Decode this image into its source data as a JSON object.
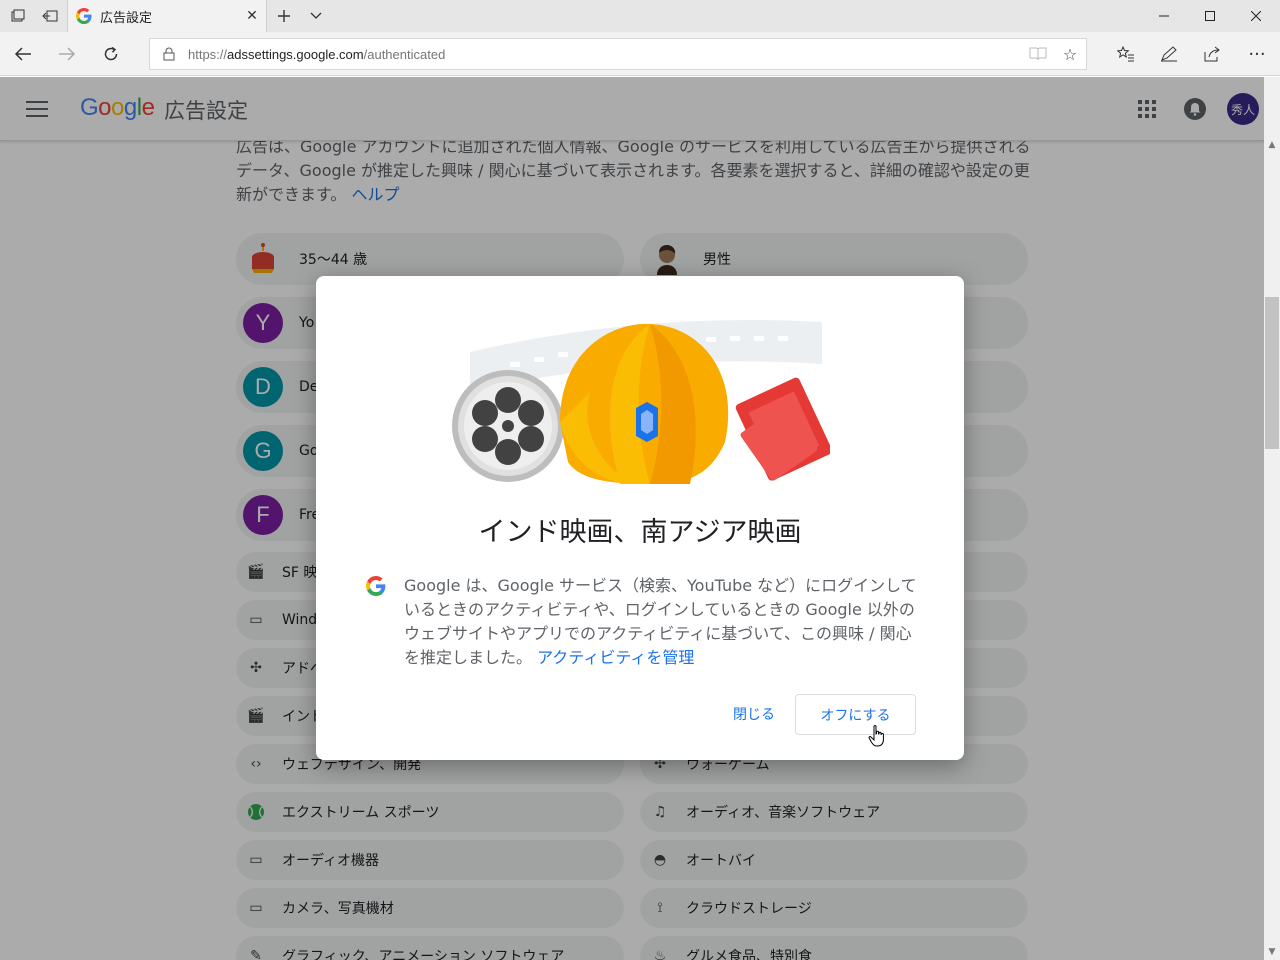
{
  "browser": {
    "tab_title": "広告設定",
    "url_scheme": "https://",
    "url_host": "adssettings.google.com",
    "url_path": "/authenticated",
    "window_buttons": [
      "minimize-icon",
      "maximize-icon",
      "close-icon"
    ]
  },
  "header": {
    "logo_text": "Google",
    "product_name": "広告設定",
    "avatar_text": "秀人",
    "avatar_color": "#3b2a88"
  },
  "intro": {
    "text": "広告は、Google アカウントに追加された個人情報、Google のサービスを利用している広告主から提供されるデータ、Google が推定した興味 / 関心に基づいて表示されます。各要素を選択すると、詳細の確認や設定の更新ができます。",
    "help_link": "ヘルプ"
  },
  "tiles": {
    "left": [
      {
        "label": "35～44 歳",
        "avatar": "",
        "color": ""
      },
      {
        "label": "Yo",
        "avatar": "Y",
        "color": "#7b1fa2"
      },
      {
        "label": "De",
        "avatar": "D",
        "color": "#0097a7"
      },
      {
        "label": "Go",
        "avatar": "G",
        "color": "#0097a7"
      },
      {
        "label": "Fre",
        "avatar": "F",
        "color": "#7b1fa2"
      }
    ],
    "right": [
      {
        "label": "男性"
      }
    ],
    "small_left": [
      {
        "label": "SF 映",
        "icon": "clapper-icon"
      },
      {
        "label": "Windo",
        "icon": "laptop-icon"
      },
      {
        "label": "アドベ",
        "icon": "gamepad-icon"
      },
      {
        "label": "インド",
        "icon": "clapper-icon"
      },
      {
        "label": "ウェブデザイン、開発",
        "icon": "code-icon"
      },
      {
        "label": "エクストリーム スポーツ",
        "icon": "ball-icon"
      },
      {
        "label": "オーディオ機器",
        "icon": "laptop-icon"
      },
      {
        "label": "カメラ、写真機材",
        "icon": "laptop-icon"
      },
      {
        "label": "グラフィック、アニメーション ソフトウェア",
        "icon": "pen-icon"
      }
    ],
    "small_right": [
      {
        "label": "ウォーゲーム",
        "icon": "gamepad-icon"
      },
      {
        "label": "オーディオ、音楽ソフトウェア",
        "icon": "music-icon"
      },
      {
        "label": "オートバイ",
        "icon": "helmet-icon"
      },
      {
        "label": "クラウドストレージ",
        "icon": "antenna-icon"
      },
      {
        "label": "グルメ食品、特別食",
        "icon": "food-icon"
      }
    ]
  },
  "dialog": {
    "title": "インド映画、南アジア映画",
    "body": "Google は、Google サービス（検索、YouTube など）にログインしているときのアクティビティや、ログインしているときの Google 以外のウェブサイトやアプリでのアクティビティに基づいて、この興味 / 関心を推定しました。",
    "manage_link": "アクティビティを管理",
    "close_label": "閉じる",
    "off_label": "オフにする"
  },
  "colors": {
    "link": "#1a73e8",
    "scrim": "rgba(0,0,0,0.33)",
    "tile_bg": "#f1f3f4"
  }
}
